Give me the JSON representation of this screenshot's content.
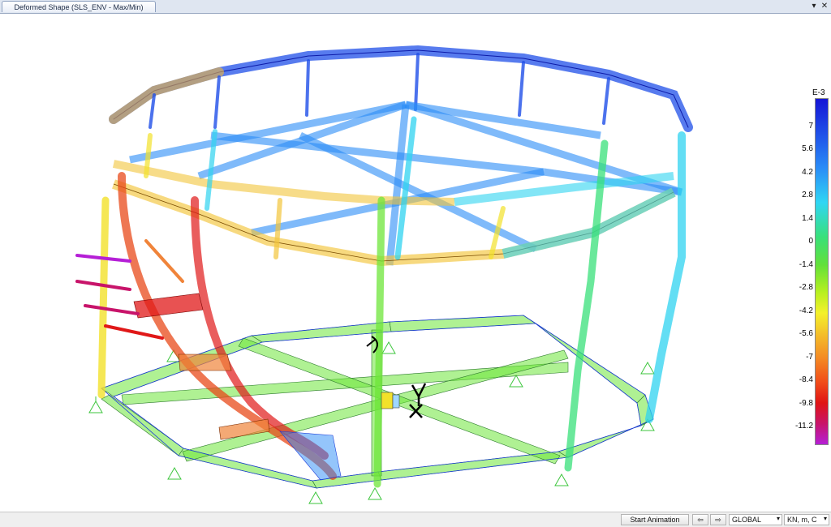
{
  "window": {
    "tab_title": "Deformed Shape (SLS_ENV - Max/Min)",
    "menu_glyph": "▾",
    "close_glyph": "✕"
  },
  "legend": {
    "units": "E-3",
    "ticks": [
      "7",
      "5.6",
      "4.2",
      "2.8",
      "1.4",
      "0",
      "-1.4",
      "-2.8",
      "-4.2",
      "-5.6",
      "-7",
      "-8.4",
      "-9.8",
      "-11.2"
    ]
  },
  "statusbar": {
    "animation_label": "Start Animation",
    "prev_glyph": "⇦",
    "next_glyph": "⇨",
    "coord_system": "GLOBAL",
    "units": "KN, m, C"
  },
  "colors": {
    "blue": "#1c2fe0",
    "cyan": "#2fd3f0",
    "green": "#6ee53a",
    "yellow": "#f2e12a",
    "orange": "#f0a83a",
    "red": "#e01818",
    "support": "#3ec63e"
  }
}
